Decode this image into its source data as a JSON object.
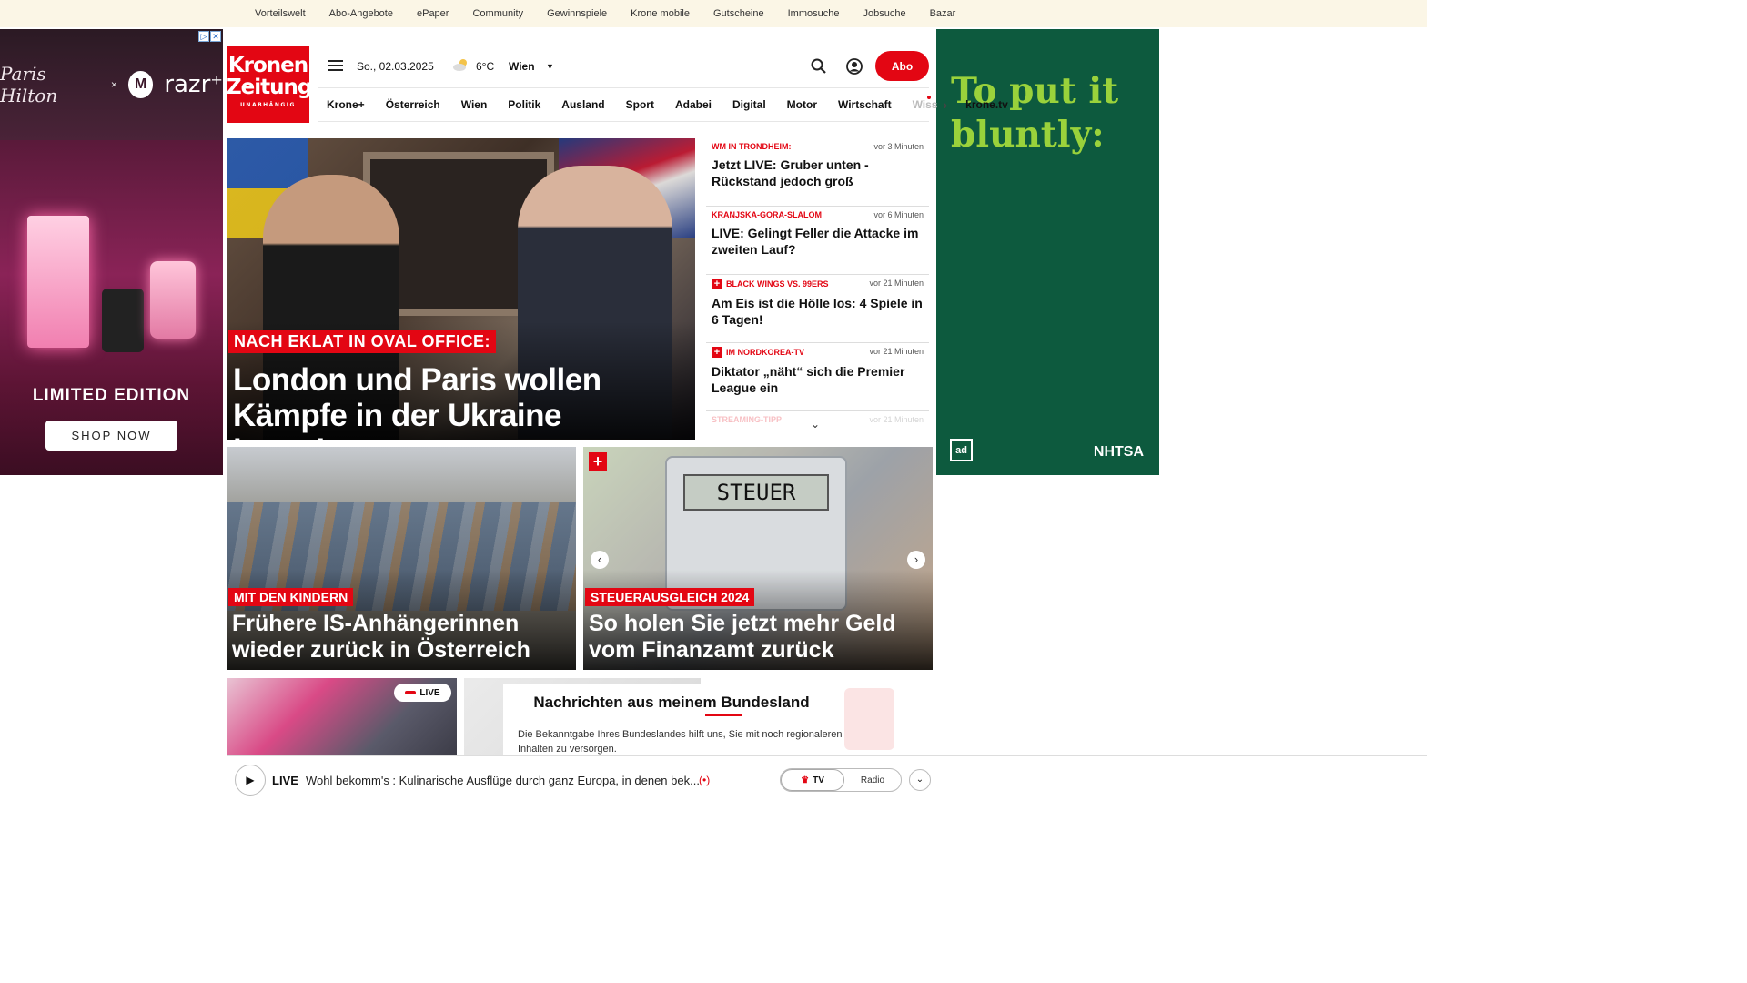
{
  "topbar": {
    "links": [
      "Vorteilswelt",
      "Abo-Angebote",
      "ePaper",
      "Community",
      "Gewinnspiele",
      "Krone mobile",
      "Gutscheine",
      "Immosuche",
      "Jobsuche",
      "Bazar"
    ]
  },
  "ad_left": {
    "brand_signature": "Paris Hilton",
    "x": "×",
    "brand_logo": "M",
    "brand_name": "razr⁺",
    "headline": "LIMITED EDITION",
    "cta": "SHOP NOW"
  },
  "ad_right": {
    "headline": "To put it bluntly:",
    "logo_left": "ad",
    "logo_right": "NHTSA",
    "bg_color": "#0d5a3e",
    "text_color": "#9ad23b"
  },
  "header": {
    "logo_line1": "Kronen",
    "logo_line2": "Zeitung",
    "logo_tagline": "UNABHÄNGIG",
    "date": "So., 02.03.2025",
    "weather_icon": "cloud-sun-icon",
    "temperature": "6°C",
    "city": "Wien",
    "abo_label": "Abo",
    "accent_color": "#e30613"
  },
  "nav": {
    "items": [
      "Krone+",
      "Österreich",
      "Wien",
      "Politik",
      "Ausland",
      "Sport",
      "Adabei",
      "Digital",
      "Motor",
      "Wirtschaft"
    ],
    "faded": "Wiss",
    "tv": "krone.tv"
  },
  "hero": {
    "kicker": "NACH EKLAT IN OVAL OFFICE:",
    "title": "London und Paris wollen Kämpfe in der Ukraine beenden"
  },
  "news_list": [
    {
      "kicker": "WM IN TRONDHEIM:",
      "time": "vor 3 Minuten",
      "headline": "Jetzt LIVE: Gruber unten - Rückstand jedoch groß",
      "plus": false
    },
    {
      "kicker": "KRANJSKA-GORA-SLALOM",
      "time": "vor 6 Minuten",
      "headline": "LIVE: Gelingt Feller die Attacke im zweiten Lauf?",
      "plus": false
    },
    {
      "kicker": "BLACK WINGS VS. 99ERS",
      "time": "vor 21 Minuten",
      "headline": "Am Eis ist die Hölle los: 4 Spiele in 6 Tagen!",
      "plus": true
    },
    {
      "kicker": "IM NORDKOREA-TV",
      "time": "vor 21 Minuten",
      "headline": "Diktator „näht“ sich die Premier League ein",
      "plus": true
    },
    {
      "kicker": "STREAMING-TIPP",
      "time": "vor 21 Minuten",
      "headline": "",
      "plus": false
    }
  ],
  "teasers": [
    {
      "kicker": "MIT DEN KINDERN",
      "title": "Frühere IS-Anhängerinnen wieder zurück in Österreich"
    },
    {
      "kicker": "STEUERAUSGLEICH 2024",
      "title": "So holen Sie jetzt mehr Geld vom Finanzamt zurück",
      "calculator_text": "STEUER"
    }
  ],
  "live_teaser": {
    "badge": "LIVE"
  },
  "bundesland_popup": {
    "title": "Nachrichten aus meinem Bundesland",
    "text": "Die Bekanntgabe Ihres Bundeslandes hilft uns, Sie mit noch regionaleren Inhalten zu versorgen."
  },
  "player": {
    "live_label": "LIVE",
    "show_title": "Wohl bekomm's : Kulinarische Ausflüge durch ganz Europa, in denen bek...",
    "toggle_tv": "TV",
    "toggle_radio": "Radio"
  }
}
